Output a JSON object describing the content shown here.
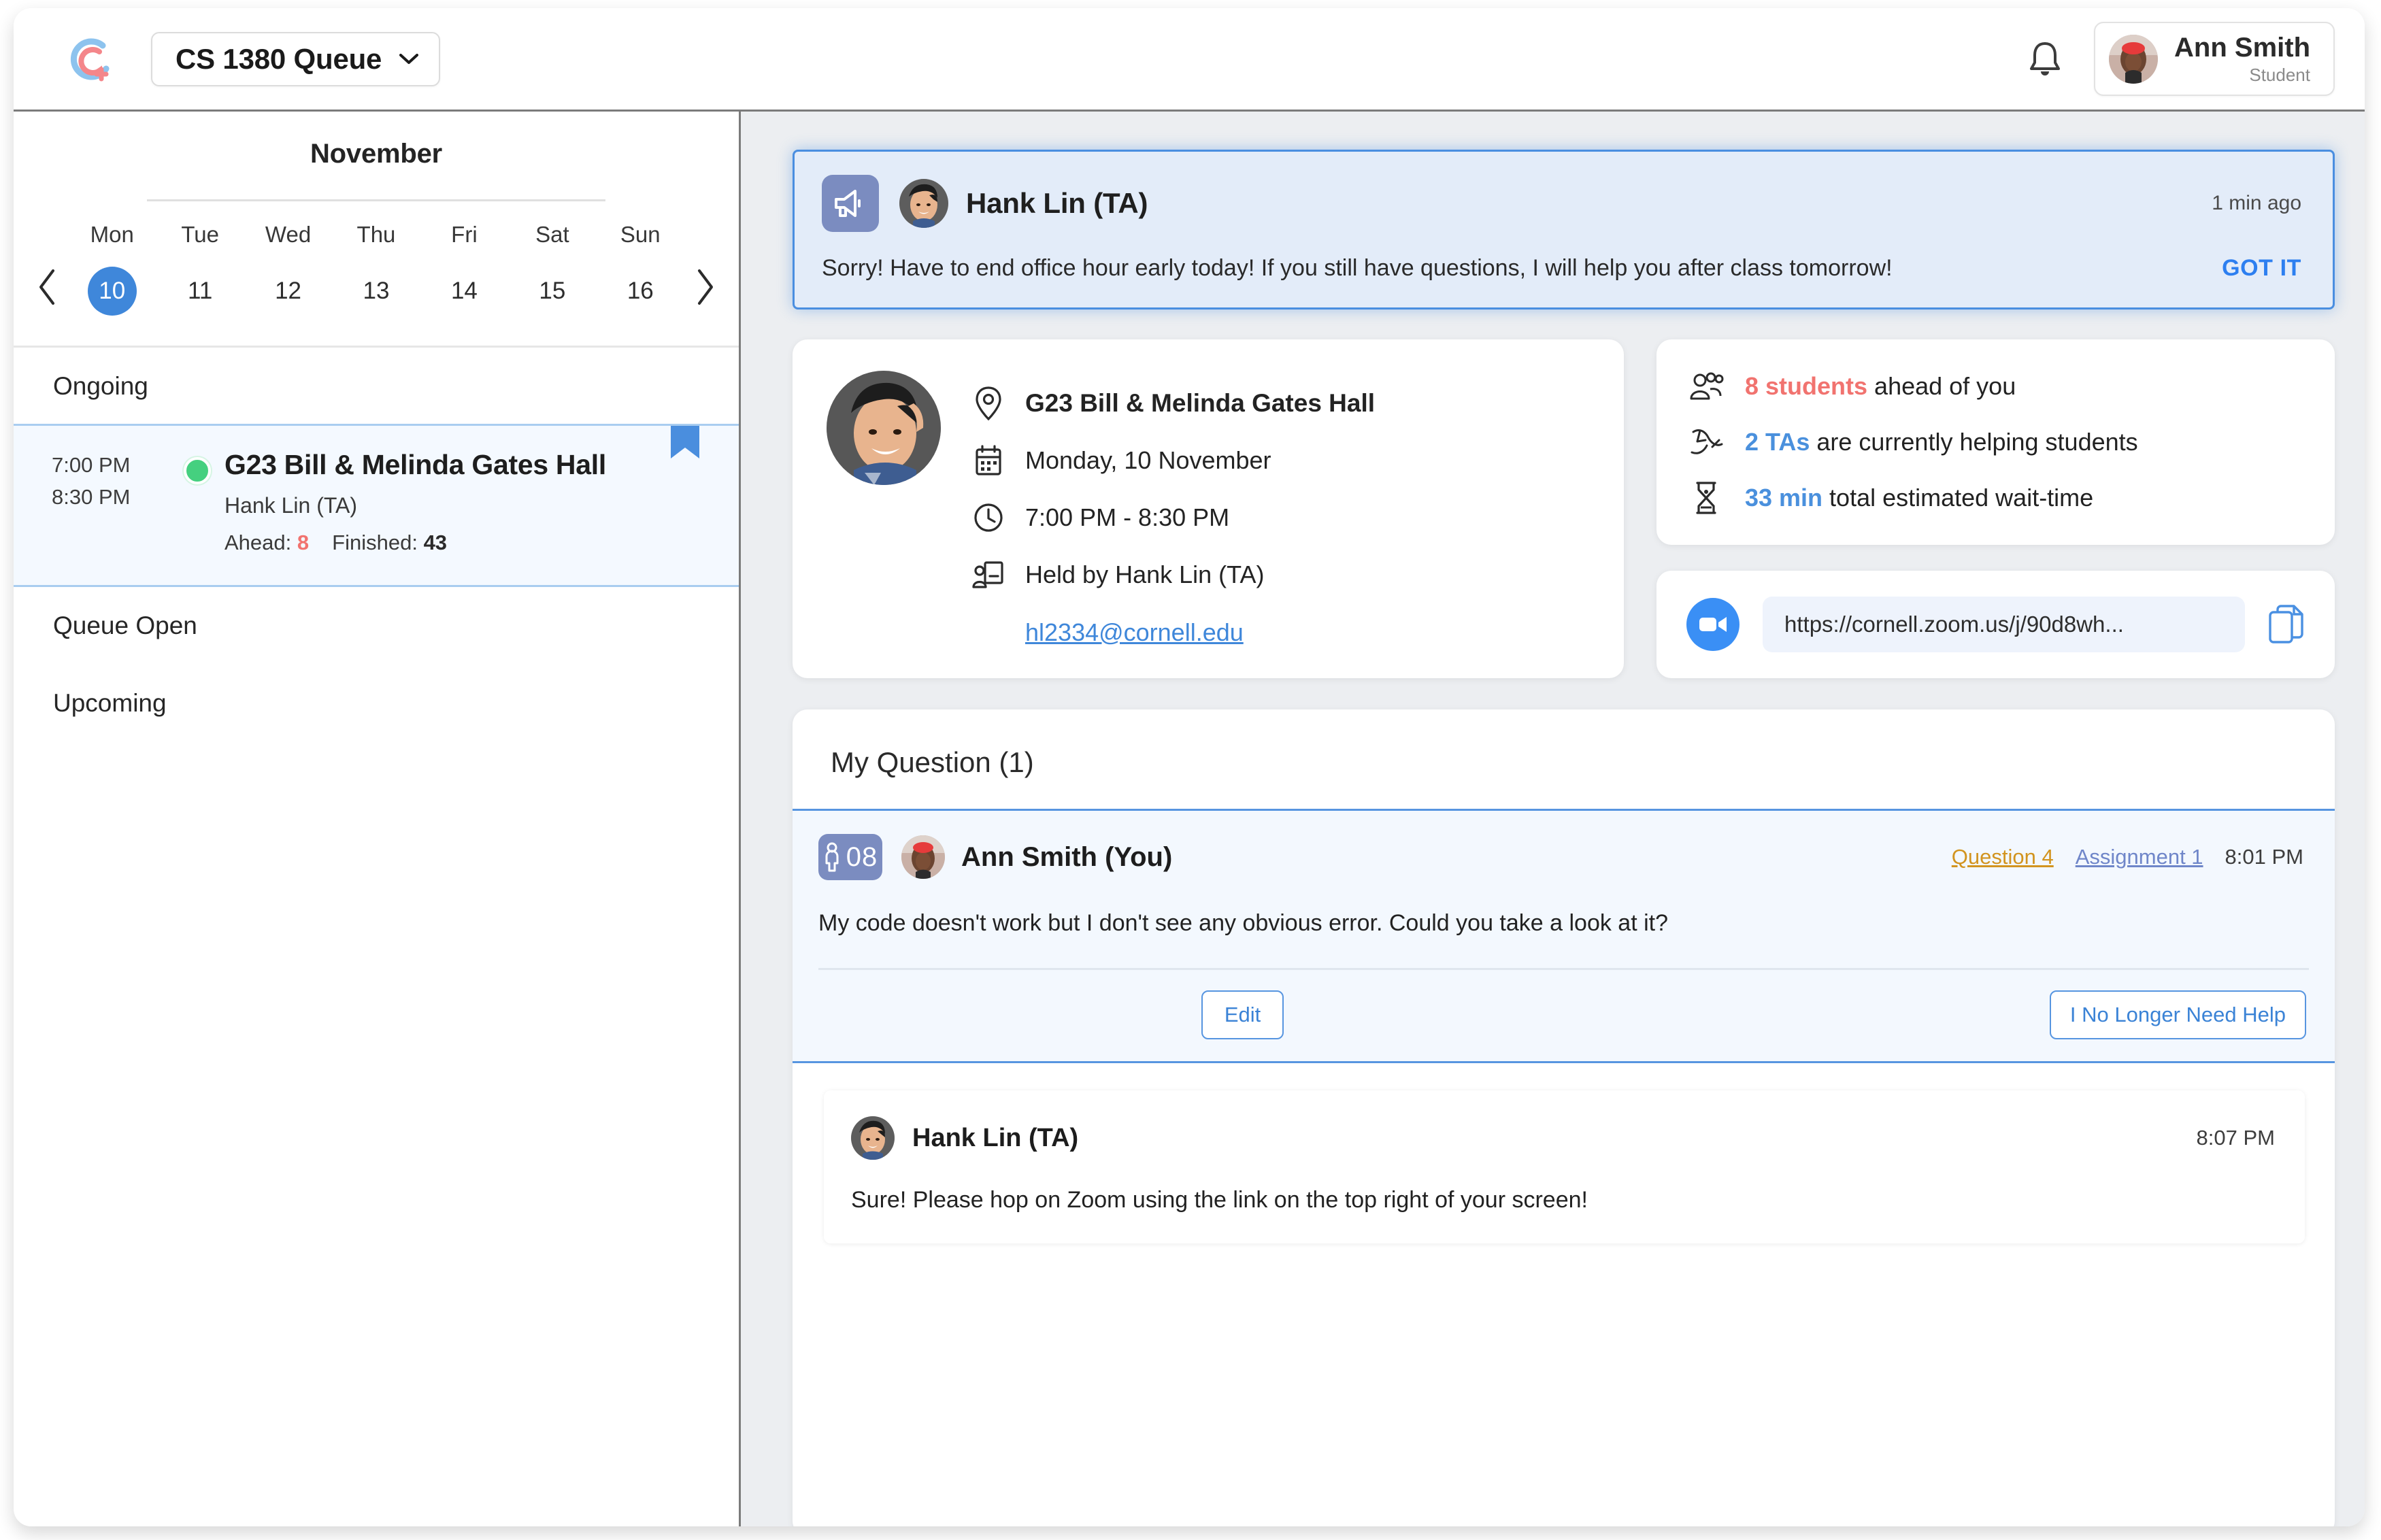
{
  "header": {
    "logo_icon": "queue-logo-icon",
    "course_select": {
      "label": "CS 1380 Queue",
      "chevron_icon": "chevron-down-icon"
    },
    "bell_icon": "notification-bell-icon",
    "user": {
      "name": "Ann Smith",
      "role": "Student",
      "avatar_icon": "user-avatar"
    }
  },
  "sidebar": {
    "calendar": {
      "month": "November",
      "prev_icon": "chevron-left-icon",
      "next_icon": "chevron-right-icon",
      "daynames": [
        "Mon",
        "Tue",
        "Wed",
        "Thu",
        "Fri",
        "Sat",
        "Sun"
      ],
      "dates": [
        "10",
        "11",
        "12",
        "13",
        "14",
        "15",
        "16"
      ],
      "selected_index": 0,
      "selected_color": "#3f87da"
    },
    "sections": [
      {
        "label": "Ongoing"
      },
      {
        "label": "Queue Open"
      },
      {
        "label": "Upcoming"
      }
    ],
    "ongoing_session": {
      "start_time": "7:00 PM",
      "end_time": "8:30 PM",
      "status_dot": "active-green-dot",
      "status_color": "#45d07f",
      "title": "G23 Bill & Melinda Gates Hall",
      "ta": "Hank Lin (TA)",
      "ahead_label": "Ahead:",
      "ahead_value": "8",
      "finished_label": "Finished:",
      "finished_value": "43",
      "bookmark_icon": "bookmark-icon"
    }
  },
  "main": {
    "announcement": {
      "megaphone_icon": "megaphone-icon",
      "author": "Hank Lin (TA)",
      "time": "1 min ago",
      "message": "Sorry! Have to end office hour early today! If you still have questions, I will help you after class tomorrow!",
      "cta": "GOT IT",
      "accent_color": "#4a8ee0"
    },
    "session_detail": {
      "ta_avatar": "ta-avatar",
      "location_icon": "location-pin-icon",
      "location": "G23 Bill & Melinda Gates Hall",
      "date_icon": "calendar-icon",
      "date": "Monday, 10 November",
      "time_icon": "clock-icon",
      "time_range": "7:00 PM - 8:30 PM",
      "host_icon": "presenter-icon",
      "host": "Held by Hank Lin (TA)",
      "email": "hl2334@cornell.edu"
    },
    "stats": {
      "students_icon": "group-people-icon",
      "students_count": "8 students",
      "students_text": " ahead of you",
      "tas_icon": "helping-hands-icon",
      "tas_count": "2 TAs",
      "tas_text": " are currently helping students",
      "wait_icon": "hourglass-icon",
      "wait_value": "33 min",
      "wait_text": " total estimated wait-time",
      "red_color": "#f1736f",
      "blue_color": "#4a90dd"
    },
    "zoom": {
      "zoom_icon": "zoom-video-icon",
      "url": "https://cornell.zoom.us/j/90d8wh...",
      "copy_icon": "copy-icon"
    },
    "question_panel": {
      "title": "My Question (1)",
      "my_question": {
        "position_icon": "person-queue-icon",
        "position": "08",
        "avatar": "student-avatar",
        "author": "Ann Smith (You)",
        "tag_question": "Question 4",
        "tag_assignment": "Assignment 1",
        "time": "8:01 PM",
        "body": "My code doesn't work but I don't see any obvious error. Could you take a look at it?",
        "edit_button": "Edit",
        "no_help_button": "I No Longer Need Help"
      },
      "ta_reply": {
        "avatar": "ta-avatar",
        "author": "Hank Lin (TA)",
        "time": "8:07 PM",
        "body": "Sure! Please hop on Zoom using the link on the top right of your screen!"
      }
    }
  }
}
